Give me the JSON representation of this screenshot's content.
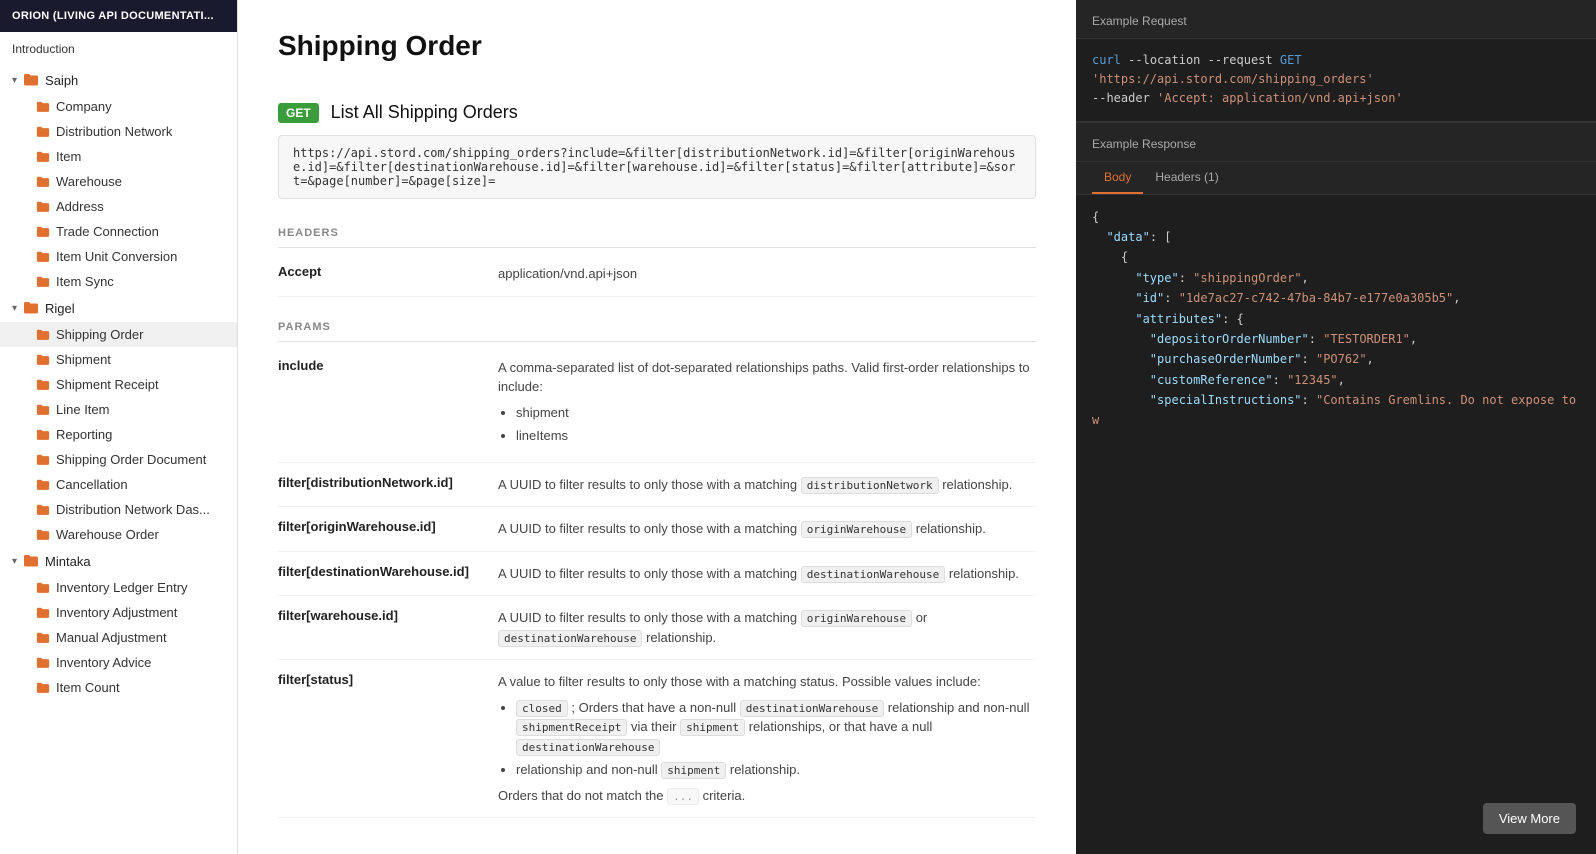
{
  "sidebar": {
    "app_title": "ORION (LIVING API DOCUMENTATI...",
    "intro_label": "Introduction",
    "groups": [
      {
        "name": "saiph",
        "label": "Saiph",
        "expanded": true,
        "items": [
          "Company",
          "Distribution Network",
          "Item",
          "Warehouse",
          "Address",
          "Trade Connection",
          "Item Unit Conversion",
          "Item Sync"
        ]
      },
      {
        "name": "rigel",
        "label": "Rigel",
        "expanded": true,
        "items": [
          "Shipping Order",
          "Shipment",
          "Shipment Receipt",
          "Line Item",
          "Reporting",
          "Shipping Order Document",
          "Cancellation",
          "Distribution Network Das...",
          "Warehouse Order"
        ]
      },
      {
        "name": "mintaka",
        "label": "Mintaka",
        "expanded": true,
        "items": [
          "Inventory Ledger Entry",
          "Inventory Adjustment",
          "Manual Adjustment",
          "Inventory Advice",
          "Item Count"
        ]
      }
    ],
    "active_item": "Shipping Order"
  },
  "main": {
    "page_title": "Shipping Order",
    "method": "GET",
    "endpoint_title": "List All Shipping Orders",
    "url": "https://api.stord.com/shipping_orders?include=&filter[distributionNetwork.id]=&filter[originWarehouse.id]=&filter[destinationWarehouse.id]=&filter[warehouse.id]=&filter[status]=&filter[attribute]=&sort=&page[number]=&page[size]=",
    "headers_label": "HEADERS",
    "params_label": "PARAMS",
    "headers": [
      {
        "name": "Accept",
        "value": "application/vnd.api+json"
      }
    ],
    "params": [
      {
        "name": "include",
        "desc": "A comma-separated list of dot-separated relationships paths. Valid first-order relationships to include:",
        "items": [
          "shipment",
          "lineItems"
        ]
      },
      {
        "name": "filter[distributionNetwork.id]",
        "desc": "A UUID to filter results to only those with a matching",
        "code": "distributionNetwork",
        "desc2": "relationship."
      },
      {
        "name": "filter[originWarehouse.id]",
        "desc": "A UUID to filter results to only those with a matching",
        "code": "originWarehouse",
        "desc2": "relationship."
      },
      {
        "name": "filter[destinationWarehouse.id]",
        "desc": "A UUID to filter results to only those with a matching",
        "code": "destinationWarehouse",
        "desc2": "relationship."
      },
      {
        "name": "filter[warehouse.id]",
        "desc": "A UUID to filter results to only those with a matching",
        "code": "originWarehouse",
        "code2": "destinationWarehouse",
        "desc2": "relationship.",
        "has_or": true
      },
      {
        "name": "filter[status]",
        "desc": "A value to filter results to only those with a matching status. Possible values include:",
        "status_items": [
          {
            "code": "closed",
            "desc": "; Orders that have a non-null",
            "code2": "destinationWarehouse",
            "desc2": "relationship and non-null",
            "code3": "shipmentReceipt",
            "desc3": "via their",
            "code4": "shipment",
            "desc4": "relationships, or that have a null",
            "code5": "destinationWarehouse"
          },
          {
            "desc": "relationship and non-null",
            "code": "shipment",
            "desc2": "relationship."
          }
        ]
      }
    ]
  },
  "right": {
    "example_request_label": "Example Request",
    "curl_line1": "curl --location --request GET 'https://api.stord.com/shipping_orders'",
    "curl_line2": "--header 'Accept: application/vnd.api+json'",
    "example_response_label": "Example Response",
    "tabs": [
      "Body",
      "Headers (1)"
    ],
    "active_tab": "Body",
    "response": {
      "data_type": "shippingOrder",
      "id": "1de7ac27-c742-47ba-84b7-e177e0a305b5",
      "depositorOrderNumber": "TESTORDER1",
      "purchaseOrderNumber": "PO762",
      "customReference": "12345",
      "specialInstructions": "Contains Gremlins. Do not expose to w"
    },
    "view_more_label": "View More"
  }
}
